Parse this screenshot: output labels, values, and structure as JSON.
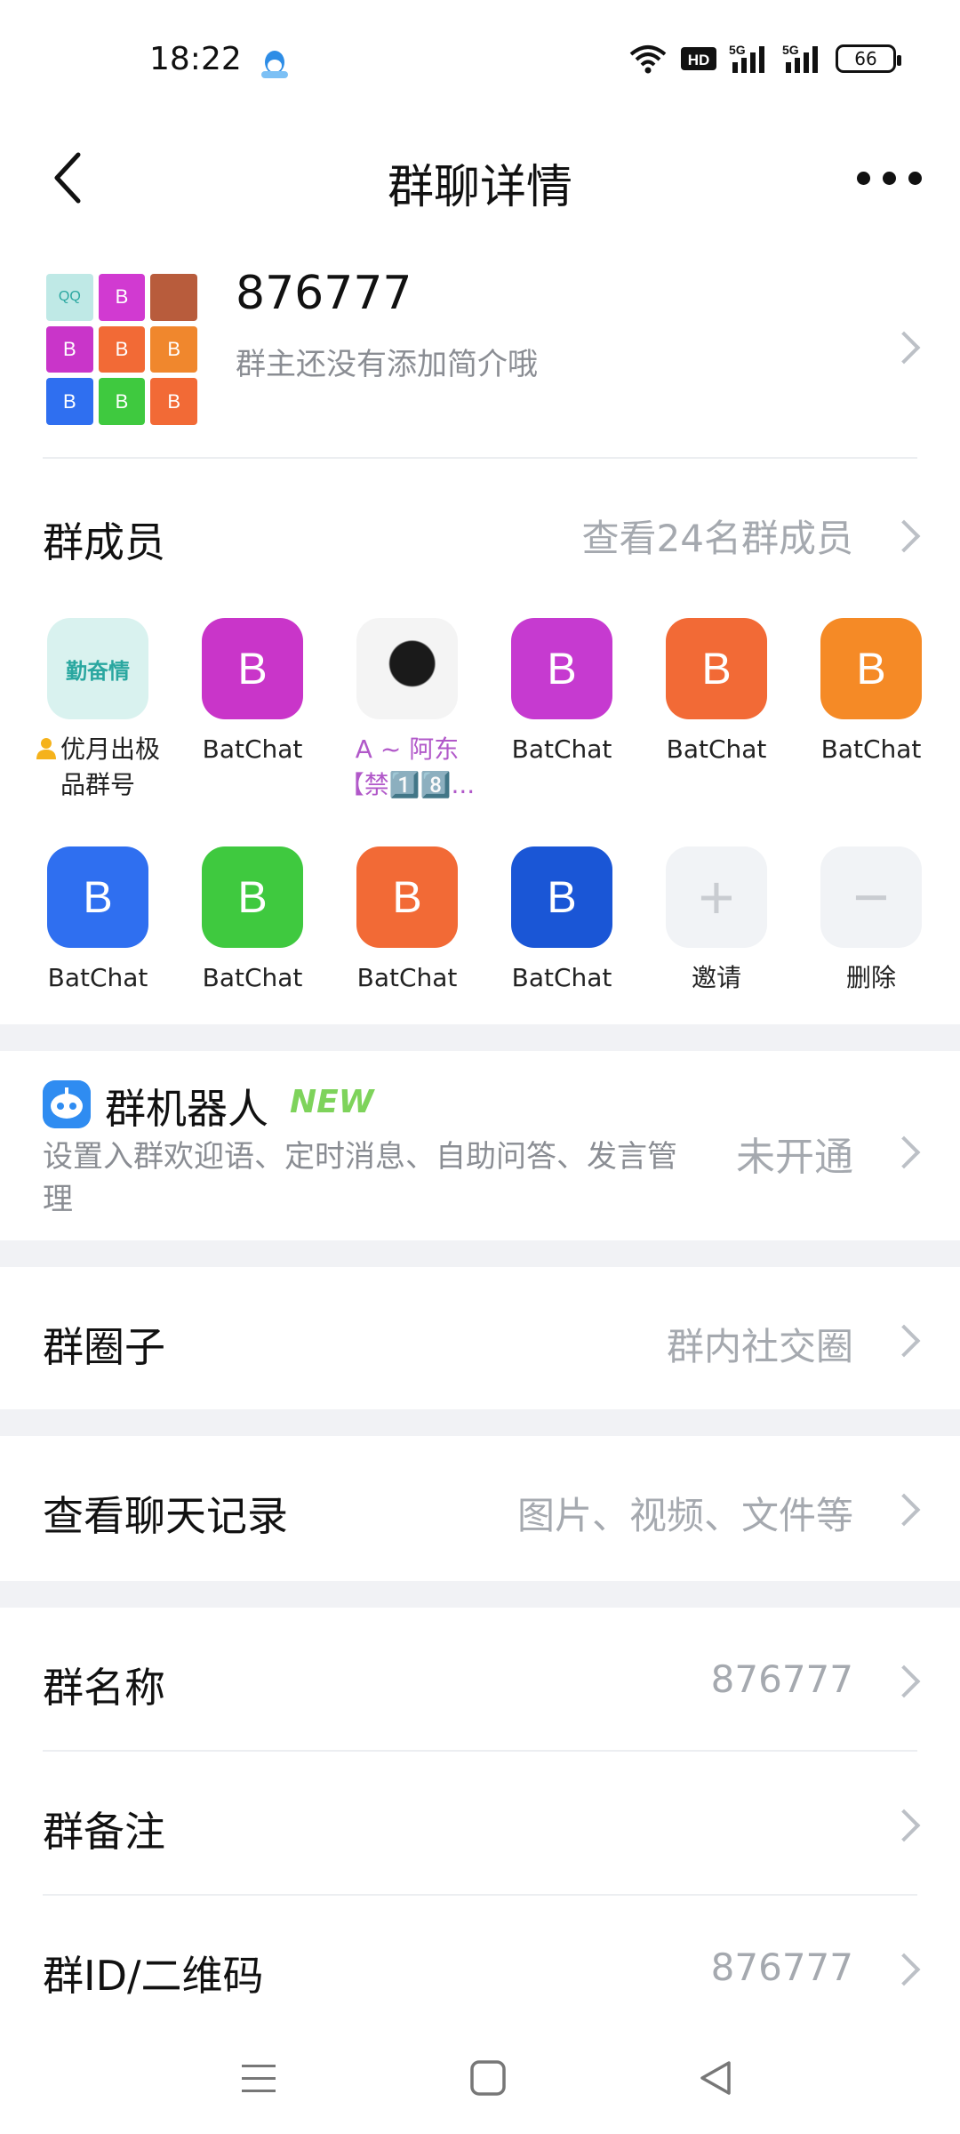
{
  "status_bar": {
    "time": "18:22",
    "network_badge": "HD",
    "signal_1": "5G",
    "signal_2": "5G",
    "battery": "66"
  },
  "header": {
    "title": "群聊详情",
    "back_icon": "chevron-left-icon",
    "more_icon": "more-dots-icon"
  },
  "group": {
    "name": "876777",
    "description": "群主还没有添加简介哦",
    "avatar_tiles": [
      {
        "label": "QQ",
        "color": "#bfe9e6"
      },
      {
        "label": "B",
        "color": "#d13ad1"
      },
      {
        "label": "",
        "color": "#b85c3c"
      },
      {
        "label": "B",
        "color": "#c935c9"
      },
      {
        "label": "B",
        "color": "#f26a36"
      },
      {
        "label": "B",
        "color": "#f0872d"
      },
      {
        "label": "B",
        "color": "#2f6ff0"
      },
      {
        "label": "B",
        "color": "#3fc93f"
      },
      {
        "label": "B",
        "color": "#f26a36"
      }
    ]
  },
  "members": {
    "label": "群成员",
    "view_all": "查看24名群成员",
    "list": [
      {
        "name_line1": "优月出极",
        "name_line2": "品群号",
        "avatar": "勤奋情",
        "color": "#d9f2ef",
        "owner": true
      },
      {
        "name_line1": "BatChat",
        "avatar": "B",
        "color": "#c935c9"
      },
      {
        "name_line1": "A ~ 阿东",
        "name_line2": "【禁1️⃣8️⃣...",
        "avatar": "",
        "color": "#e8e8e8",
        "purple": true
      },
      {
        "name_line1": "BatChat",
        "avatar": "B",
        "color": "#c63ad0"
      },
      {
        "name_line1": "BatChat",
        "avatar": "B",
        "color": "#f26a36"
      },
      {
        "name_line1": "BatChat",
        "avatar": "B",
        "color": "#f58a26"
      },
      {
        "name_line1": "BatChat",
        "avatar": "B",
        "color": "#2f6ff0"
      },
      {
        "name_line1": "BatChat",
        "avatar": "B",
        "color": "#3fc93f"
      },
      {
        "name_line1": "BatChat",
        "avatar": "B",
        "color": "#f26a36"
      },
      {
        "name_line1": "BatChat",
        "avatar": "B",
        "color": "#1a56d6"
      },
      {
        "name_line1": "邀请",
        "avatar": "+",
        "color": "#f1f3f6"
      },
      {
        "name_line1": "删除",
        "avatar": "−",
        "color": "#f1f3f6"
      }
    ]
  },
  "robot": {
    "title": "群机器人",
    "badge": "NEW",
    "description": "设置入群欢迎语、定时消息、自助问答、发言管理",
    "status": "未开通"
  },
  "circle": {
    "label": "群圈子",
    "value": "群内社交圈"
  },
  "chat_history": {
    "label": "查看聊天记录",
    "value": "图片、视频、文件等"
  },
  "group_name": {
    "label": "群名称",
    "value": "876777"
  },
  "group_remark": {
    "label": "群备注",
    "value": ""
  },
  "group_id": {
    "label": "群ID/二维码",
    "value": "876777"
  },
  "navbar": {
    "menu_icon": "menu-icon",
    "home_icon": "home-icon",
    "back_icon": "back-triangle-icon"
  }
}
